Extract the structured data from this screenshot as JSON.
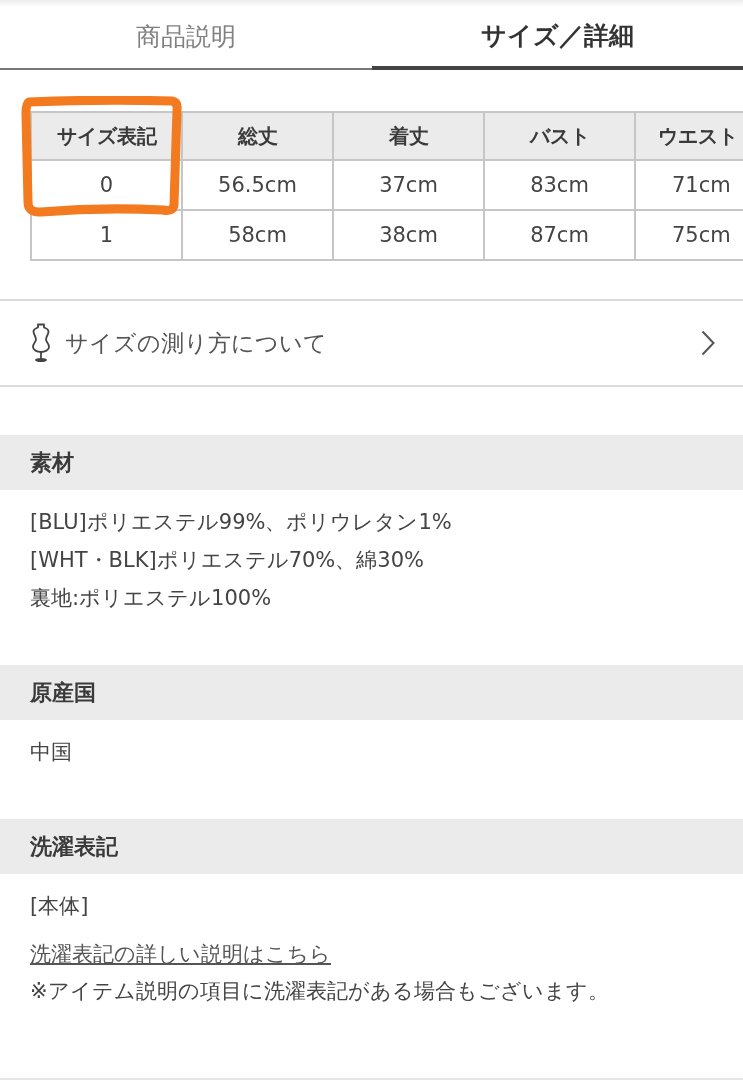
{
  "tabs": [
    {
      "label": "商品説明",
      "selected": false
    },
    {
      "label": "サイズ／詳細",
      "selected": true
    }
  ],
  "size_table": {
    "columns": [
      {
        "label": "サイズ表記",
        "highlighted": true
      },
      {
        "label": "総丈",
        "highlighted": false
      },
      {
        "label": "着丈",
        "highlighted": false
      },
      {
        "label": "バスト",
        "highlighted": false
      },
      {
        "label": "ウエスト",
        "highlighted": false
      }
    ],
    "rows": [
      {
        "cells": [
          "0",
          "56.5cm",
          "37cm",
          "83cm",
          "71cm"
        ],
        "highlighted": true
      },
      {
        "cells": [
          "1",
          "58cm",
          "38cm",
          "87cm",
          "75cm"
        ],
        "highlighted": false
      }
    ]
  },
  "measure_guide": {
    "label": "サイズの測り方について"
  },
  "sections": [
    {
      "title": "素材",
      "items": [
        {
          "kind": "text",
          "text": "[BLU]ポリエステル99%、ポリウレタン1%"
        },
        {
          "kind": "text",
          "text": "[WHT・BLK]ポリエステル70%、綿30%"
        },
        {
          "kind": "text",
          "text": "裏地:ポリエステル100%"
        }
      ]
    },
    {
      "title": "原産国",
      "items": [
        {
          "kind": "text",
          "text": "中国"
        }
      ]
    },
    {
      "title": "洗濯表記",
      "items": [
        {
          "kind": "text",
          "text": "[本体]"
        },
        {
          "kind": "link",
          "text": "洗濯表記の詳しい説明はこちら"
        },
        {
          "kind": "text",
          "text": "※アイテム説明の項目に洗濯表記がある場合もございます。"
        }
      ]
    }
  ]
}
